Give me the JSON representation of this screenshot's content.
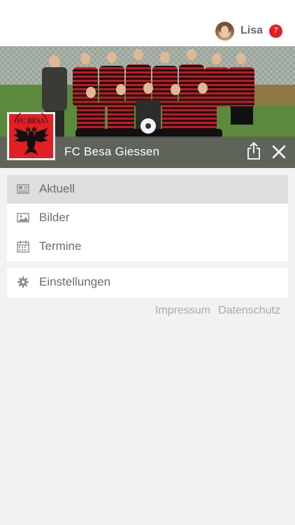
{
  "user": {
    "name": "Lisa",
    "notification_count": "7",
    "avatar_icon": "avatar-photo"
  },
  "club": {
    "name": "FC Besa Giessen",
    "logo_text": "FC BESA"
  },
  "menu": {
    "items": [
      {
        "label": "Aktuell",
        "icon": "newspaper-icon",
        "active": true
      },
      {
        "label": "Bilder",
        "icon": "image-icon",
        "active": false
      },
      {
        "label": "Termine",
        "icon": "calendar-icon",
        "active": false
      }
    ],
    "settings": {
      "label": "Einstellungen",
      "icon": "gear-icon"
    }
  },
  "footer_links": {
    "impressum": "Impressum",
    "datenschutz": "Datenschutz"
  },
  "colors": {
    "accent": "#e31e24",
    "overlay": "#5f5f5f",
    "text": "#6b6b6b",
    "link": "#a9a9a9"
  }
}
